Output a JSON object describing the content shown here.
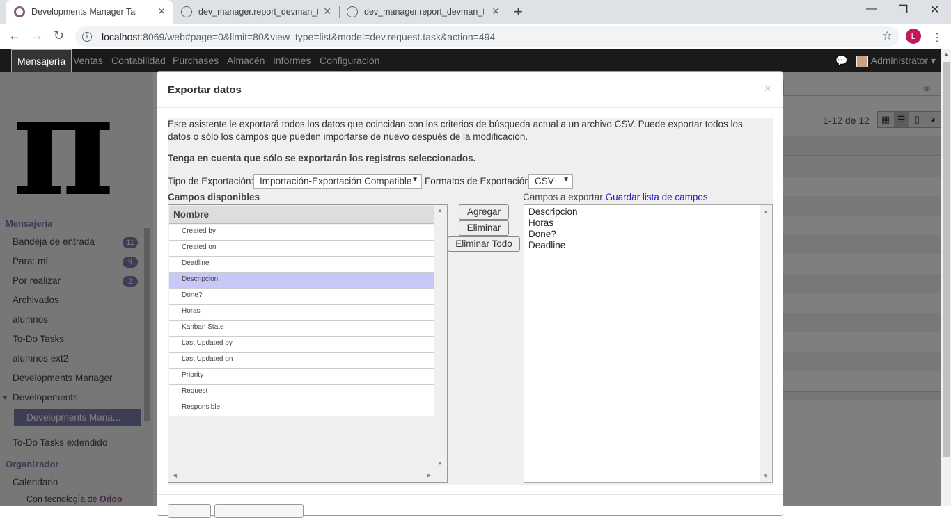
{
  "browser": {
    "tabs": [
      {
        "title": "Developments Manager Task - O",
        "active": true
      },
      {
        "title": "dev_manager.report_devman_tas",
        "active": false
      },
      {
        "title": "dev_manager.report_devman_tas",
        "active": false
      }
    ],
    "url_host": "localhost",
    "url_rest": ":8069/web#page=0&limit=80&view_type=list&model=dev.request.task&action=494",
    "profile_letter": "L"
  },
  "topbar": {
    "menus": [
      "Mensajería",
      "Ventas",
      "Contabilidad",
      "Purchases",
      "Almacén",
      "Informes",
      "Configuración"
    ],
    "user": "Administrator"
  },
  "sidebar": {
    "section1": "Mensajería",
    "items": [
      {
        "label": "Bandeja de entrada",
        "badge": "11"
      },
      {
        "label": "Para: mí",
        "badge": "9"
      },
      {
        "label": "Por realizar",
        "badge": "2"
      },
      {
        "label": "Archivados"
      },
      {
        "label": "alumnos"
      },
      {
        "label": "To-Do Tasks"
      },
      {
        "label": "alumnos ext2"
      },
      {
        "label": "Developments Manager"
      },
      {
        "label": "Developements"
      }
    ],
    "active_item": "Developments Mana...",
    "item_after": "To-Do Tasks extendido",
    "section2": "Organizador",
    "calendar": "Calendario",
    "footer_prefix": "Con tecnología de",
    "footer_brand": "Odoo"
  },
  "list": {
    "pager": "1-12 de 12"
  },
  "modal": {
    "title": "Exportar datos",
    "intro": "Este asistente le exportará todos los datos que coincidan con los criterios de búsqueda actual a un archivo CSV. Puede exportar todos los datos o sólo los campos que pueden importarse de nuevo después de la modificación.",
    "note": "Tenga en cuenta que sólo se exportarán los registros seleccionados.",
    "export_type_label": "Tipo de Exportación:",
    "export_type_value": "Importación-Exportación Compatible",
    "format_label": "Formatos de Exportación",
    "format_value": "CSV",
    "available_title": "Campos disponibles",
    "tree_header": "Nombre",
    "fields": [
      "Created by",
      "Created on",
      "Deadline",
      "Descripcion",
      "Done?",
      "Horas",
      "Kanban State",
      "Last Updated by",
      "Last Updated on",
      "Priority",
      "Request",
      "Responsible"
    ],
    "highlighted_field": "Descripcion",
    "btn_add": "Agregar",
    "btn_remove": "Eliminar",
    "btn_remove_all": "Eliminar Todo",
    "export_title": "Campos a exportar",
    "save_list_link": "Guardar lista de campos",
    "export_fields": [
      "Descripcion",
      "Horas",
      "Done?",
      "Deadline"
    ]
  }
}
